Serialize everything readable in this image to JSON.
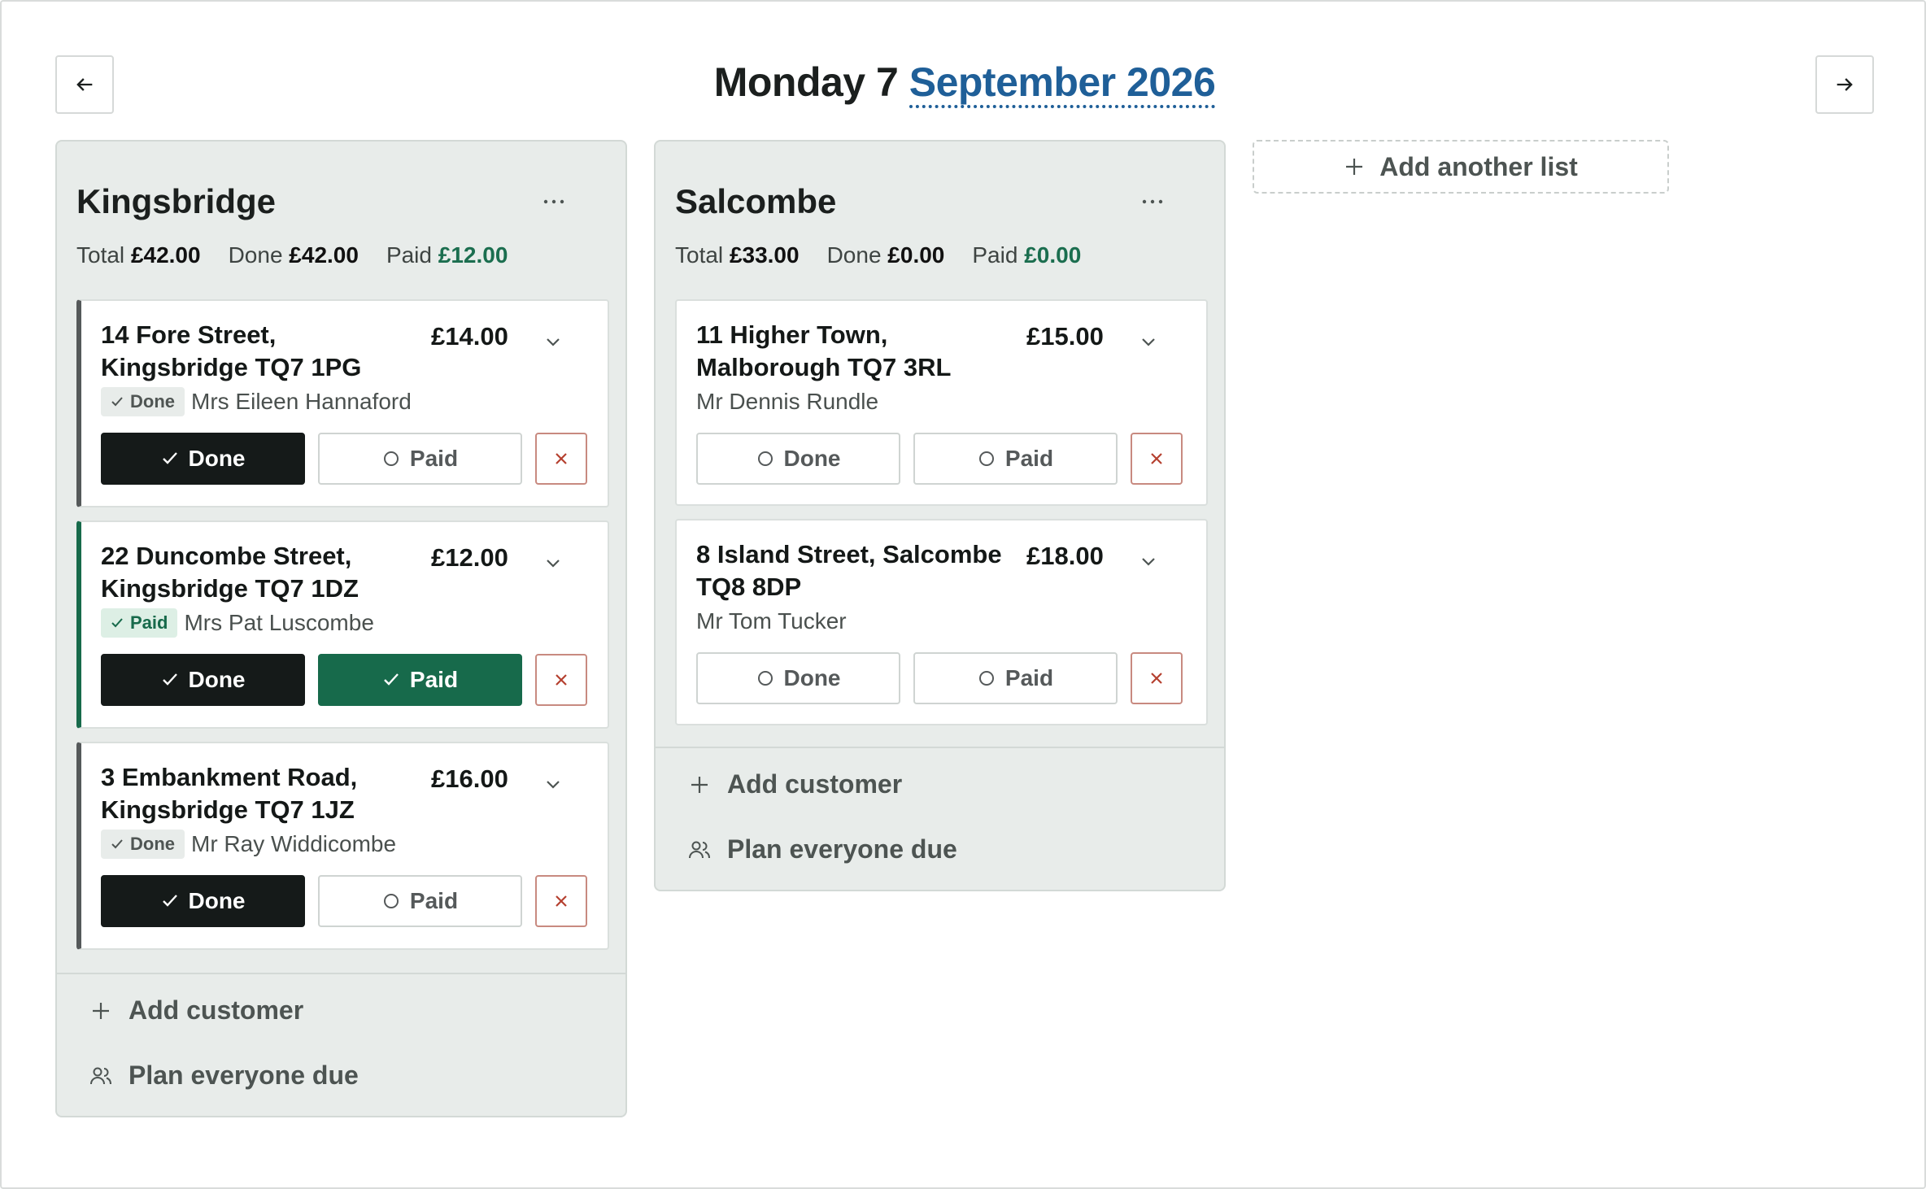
{
  "header": {
    "day_label": "Monday 7",
    "month_label": "September 2026"
  },
  "lists": [
    {
      "name": "Kingsbridge",
      "totals": {
        "total_label": "Total",
        "total_value": "£42.00",
        "done_label": "Done",
        "done_value": "£42.00",
        "paid_label": "Paid",
        "paid_value": "£12.00"
      },
      "cards": [
        {
          "address": "14 Fore Street, Kingsbridge TQ7 1PG",
          "price": "£14.00",
          "status_badge": "Done",
          "customer": "Mrs Eileen Hannaford",
          "done_label": "Done",
          "paid_label": "Paid"
        },
        {
          "address": "22 Duncombe Street, Kingsbridge TQ7 1DZ",
          "price": "£12.00",
          "status_badge": "Paid",
          "customer": "Mrs Pat Luscombe",
          "done_label": "Done",
          "paid_label": "Paid"
        },
        {
          "address": "3 Embankment Road, Kingsbridge TQ7 1JZ",
          "price": "£16.00",
          "status_badge": "Done",
          "customer": "Mr Ray Widdicombe",
          "done_label": "Done",
          "paid_label": "Paid"
        }
      ],
      "add_customer_label": "Add customer",
      "plan_label": "Plan everyone due"
    },
    {
      "name": "Salcombe",
      "totals": {
        "total_label": "Total",
        "total_value": "£33.00",
        "done_label": "Done",
        "done_value": "£0.00",
        "paid_label": "Paid",
        "paid_value": "£0.00"
      },
      "cards": [
        {
          "address": "11 Higher Town, Malborough TQ7 3RL",
          "price": "£15.00",
          "customer": "Mr Dennis Rundle",
          "done_label": "Done",
          "paid_label": "Paid"
        },
        {
          "address": "8 Island Street, Salcombe TQ8 8DP",
          "price": "£18.00",
          "customer": "Mr Tom Tucker",
          "done_label": "Done",
          "paid_label": "Paid"
        }
      ],
      "add_customer_label": "Add customer",
      "plan_label": "Plan everyone due"
    }
  ],
  "add_list_label": "Add another list",
  "colors": {
    "accent_blue": "#1f5f98",
    "paid_green": "#176a4b",
    "done_dark": "#151a19",
    "delete_red": "#b5402f",
    "list_bg": "#e8ecea"
  },
  "icons": {
    "prev": "arrow-left-icon",
    "next": "arrow-right-icon",
    "more": "ellipsis-icon",
    "expand": "chevron-down-icon",
    "check": "check-icon",
    "unchecked": "circle-icon",
    "delete": "close-icon",
    "add": "plus-icon",
    "plan": "users-icon"
  }
}
